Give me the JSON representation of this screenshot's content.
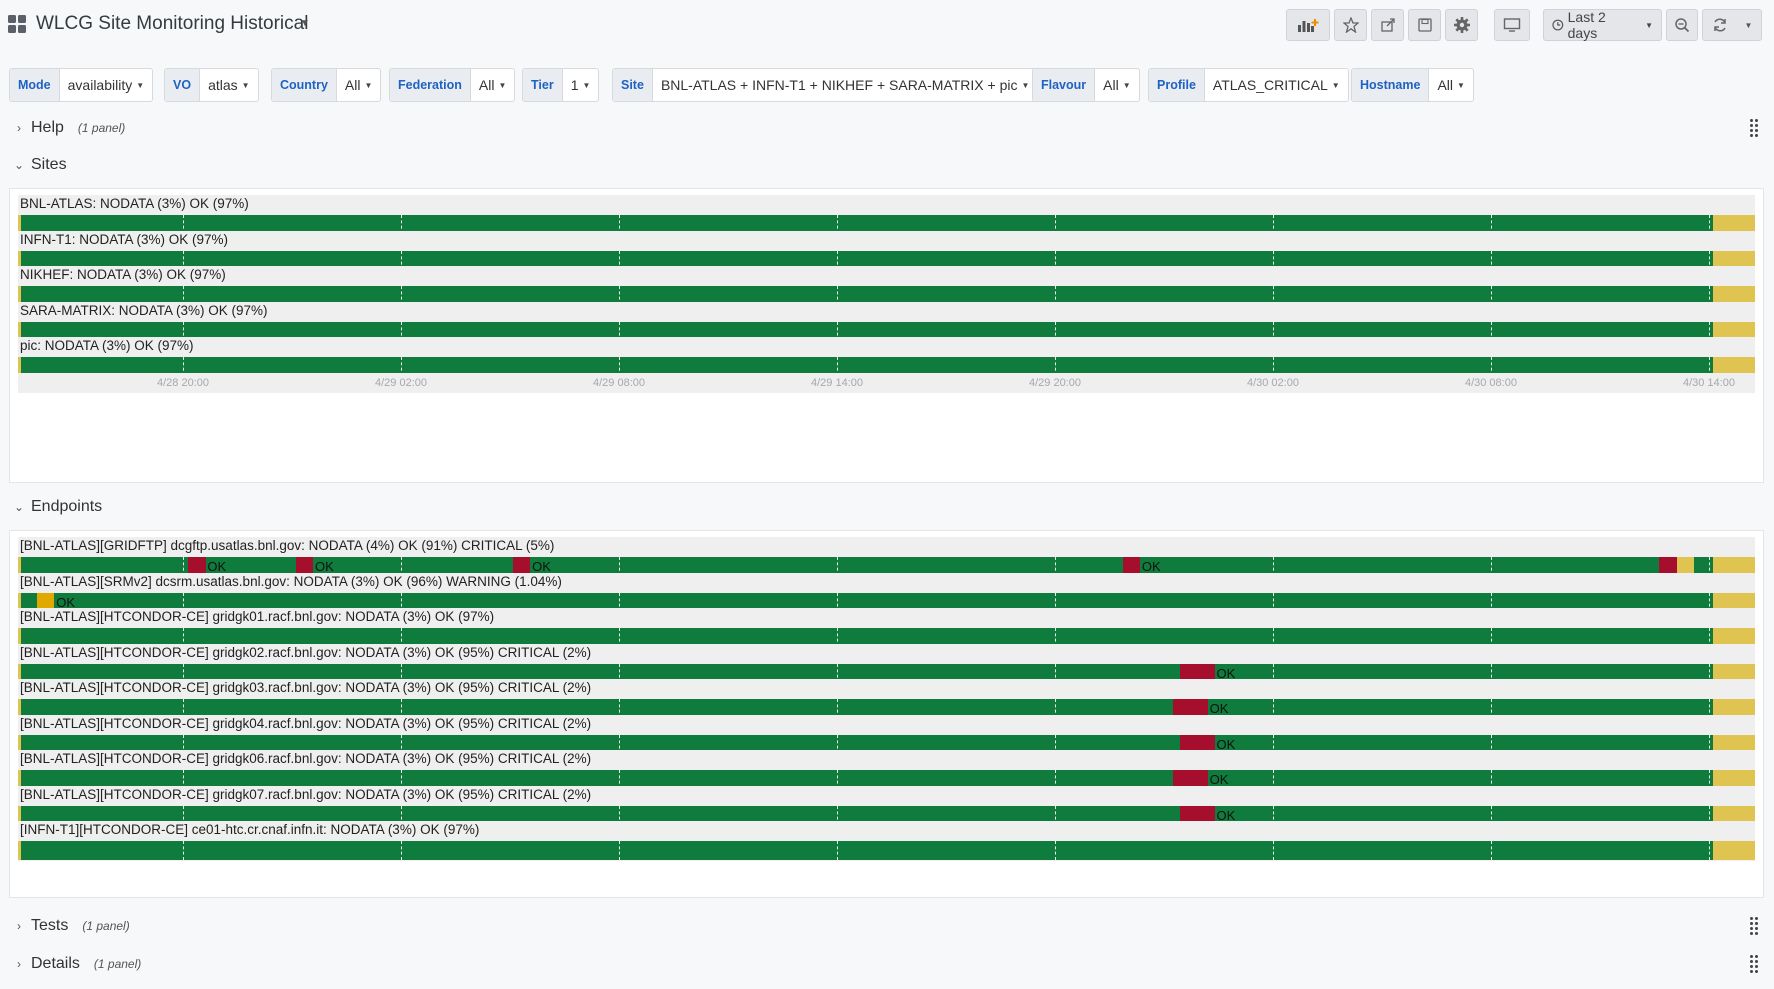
{
  "dashboard": {
    "title": "WLCG Site Monitoring Historical",
    "time_range": "Last 2 days"
  },
  "toolbar": {
    "icons": [
      "add-panel-icon",
      "star-icon",
      "share-icon",
      "save-icon",
      "gear-icon",
      "tv-mode-icon",
      "clock-icon",
      "zoom-out-icon",
      "refresh-icon",
      "chevron-down-icon"
    ]
  },
  "variables": [
    {
      "label": "Mode",
      "value": "availability"
    },
    {
      "label": "VO",
      "value": "atlas"
    },
    {
      "label": "Country",
      "value": "All"
    },
    {
      "label": "Federation",
      "value": "All"
    },
    {
      "label": "Tier",
      "value": "1"
    },
    {
      "label": "Site",
      "value": "BNL-ATLAS + INFN-T1 + NIKHEF + SARA-MATRIX + pic"
    },
    {
      "label": "Flavour",
      "value": "All"
    },
    {
      "label": "Profile",
      "value": "ATLAS_CRITICAL"
    },
    {
      "label": "Hostname",
      "value": "All"
    }
  ],
  "rows": {
    "help": {
      "title": "Help",
      "count": "(1 panel)"
    },
    "sites": {
      "title": "Sites"
    },
    "endpoints": {
      "title": "Endpoints"
    },
    "tests": {
      "title": "Tests",
      "count": "(1 panel)"
    },
    "details": {
      "title": "Details",
      "count": "(1 panel)"
    }
  },
  "colors": {
    "ok": "#0f7b3c",
    "critical": "#a50f2d",
    "warning": "#e0a800",
    "nodata": "#dfc452"
  },
  "time_axis": {
    "ticks": [
      "4/28 20:00",
      "4/29 02:00",
      "4/29 08:00",
      "4/29 14:00",
      "4/29 20:00",
      "4/30 02:00",
      "4/30 08:00",
      "4/30 14:00"
    ],
    "tick_fractions": [
      0.095,
      0.2205,
      0.346,
      0.4715,
      0.597,
      0.7225,
      0.848,
      0.9735
    ]
  },
  "sites": [
    {
      "label": "BNL-ATLAS: NODATA (3%) OK (97%)",
      "segments": [
        {
          "state": "nodata",
          "start": 0.0,
          "end": 0.002
        },
        {
          "state": "ok",
          "start": 0.002,
          "end": 0.974
        },
        {
          "state": "nodata",
          "start": 0.976,
          "end": 1.0
        }
      ]
    },
    {
      "label": "INFN-T1: NODATA (3%) OK (97%)",
      "segments": [
        {
          "state": "nodata",
          "start": 0.0,
          "end": 0.002
        },
        {
          "state": "ok",
          "start": 0.002,
          "end": 0.974
        },
        {
          "state": "nodata",
          "start": 0.976,
          "end": 1.0
        }
      ]
    },
    {
      "label": "NIKHEF: NODATA (3%) OK (97%)",
      "segments": [
        {
          "state": "nodata",
          "start": 0.0,
          "end": 0.002
        },
        {
          "state": "ok",
          "start": 0.002,
          "end": 0.974
        },
        {
          "state": "nodata",
          "start": 0.976,
          "end": 1.0
        }
      ]
    },
    {
      "label": "SARA-MATRIX: NODATA (3%) OK (97%)",
      "segments": [
        {
          "state": "nodata",
          "start": 0.0,
          "end": 0.002
        },
        {
          "state": "ok",
          "start": 0.002,
          "end": 0.974
        },
        {
          "state": "nodata",
          "start": 0.976,
          "end": 1.0
        }
      ]
    },
    {
      "label": "pic: NODATA (3%) OK (97%)",
      "segments": [
        {
          "state": "nodata",
          "start": 0.0,
          "end": 0.002
        },
        {
          "state": "ok",
          "start": 0.002,
          "end": 0.974
        },
        {
          "state": "nodata",
          "start": 0.976,
          "end": 1.0
        }
      ]
    }
  ],
  "endpoints": [
    {
      "label": "[BNL-ATLAS][GRIDFTP] dcgftp.usatlas.bnl.gov: NODATA (4%) OK (91%) CRITICAL (5%)",
      "segments": [
        {
          "state": "nodata",
          "start": 0.0,
          "end": 0.002
        },
        {
          "state": "critical",
          "start": 0.098,
          "end": 0.108
        },
        {
          "state": "critical",
          "start": 0.16,
          "end": 0.17
        },
        {
          "state": "critical",
          "start": 0.285,
          "end": 0.295
        },
        {
          "state": "critical",
          "start": 0.636,
          "end": 0.646
        },
        {
          "state": "critical",
          "start": 0.945,
          "end": 0.955
        },
        {
          "state": "nodata",
          "start": 0.955,
          "end": 0.965
        },
        {
          "state": "nodata",
          "start": 0.976,
          "end": 1.0
        }
      ],
      "annotations": [
        {
          "text": "OK",
          "at": 0.109
        },
        {
          "text": "OK",
          "at": 0.171
        },
        {
          "text": "OK",
          "at": 0.296
        },
        {
          "text": "OK",
          "at": 0.647
        }
      ]
    },
    {
      "label": "[BNL-ATLAS][SRMv2] dcsrm.usatlas.bnl.gov: NODATA (3%) OK (96%) WARNING (1.04%)",
      "segments": [
        {
          "state": "nodata",
          "start": 0.0,
          "end": 0.002
        },
        {
          "state": "warning",
          "start": 0.011,
          "end": 0.021
        },
        {
          "state": "nodata",
          "start": 0.976,
          "end": 1.0
        }
      ],
      "annotations": [
        {
          "text": "OK",
          "at": 0.022
        }
      ]
    },
    {
      "label": "[BNL-ATLAS][HTCONDOR-CE] gridgk01.racf.bnl.gov: NODATA (3%) OK (97%)",
      "segments": [
        {
          "state": "nodata",
          "start": 0.0,
          "end": 0.002
        },
        {
          "state": "nodata",
          "start": 0.976,
          "end": 1.0
        }
      ],
      "annotations": []
    },
    {
      "label": "[BNL-ATLAS][HTCONDOR-CE] gridgk02.racf.bnl.gov: NODATA (3%) OK (95%) CRITICAL (2%)",
      "segments": [
        {
          "state": "nodata",
          "start": 0.0,
          "end": 0.002
        },
        {
          "state": "critical",
          "start": 0.669,
          "end": 0.689
        },
        {
          "state": "nodata",
          "start": 0.976,
          "end": 1.0
        }
      ],
      "annotations": [
        {
          "text": "OK",
          "at": 0.69
        }
      ]
    },
    {
      "label": "[BNL-ATLAS][HTCONDOR-CE] gridgk03.racf.bnl.gov: NODATA (3%) OK (95%) CRITICAL (2%)",
      "segments": [
        {
          "state": "nodata",
          "start": 0.0,
          "end": 0.002
        },
        {
          "state": "critical",
          "start": 0.665,
          "end": 0.685
        },
        {
          "state": "nodata",
          "start": 0.976,
          "end": 1.0
        }
      ],
      "annotations": [
        {
          "text": "OK",
          "at": 0.686
        }
      ]
    },
    {
      "label": "[BNL-ATLAS][HTCONDOR-CE] gridgk04.racf.bnl.gov: NODATA (3%) OK (95%) CRITICAL (2%)",
      "segments": [
        {
          "state": "nodata",
          "start": 0.0,
          "end": 0.002
        },
        {
          "state": "critical",
          "start": 0.669,
          "end": 0.689
        },
        {
          "state": "nodata",
          "start": 0.976,
          "end": 1.0
        }
      ],
      "annotations": [
        {
          "text": "OK",
          "at": 0.69
        }
      ]
    },
    {
      "label": "[BNL-ATLAS][HTCONDOR-CE] gridgk06.racf.bnl.gov: NODATA (3%) OK (95%) CRITICAL (2%)",
      "segments": [
        {
          "state": "nodata",
          "start": 0.0,
          "end": 0.002
        },
        {
          "state": "critical",
          "start": 0.665,
          "end": 0.685
        },
        {
          "state": "nodata",
          "start": 0.976,
          "end": 1.0
        }
      ],
      "annotations": [
        {
          "text": "OK",
          "at": 0.686
        }
      ]
    },
    {
      "label": "[BNL-ATLAS][HTCONDOR-CE] gridgk07.racf.bnl.gov: NODATA (3%) OK (95%) CRITICAL (2%)",
      "segments": [
        {
          "state": "nodata",
          "start": 0.0,
          "end": 0.002
        },
        {
          "state": "critical",
          "start": 0.669,
          "end": 0.689
        },
        {
          "state": "nodata",
          "start": 0.976,
          "end": 1.0
        }
      ],
      "annotations": [
        {
          "text": "OK",
          "at": 0.69
        }
      ]
    },
    {
      "label": "[INFN-T1][HTCONDOR-CE] ce01-htc.cr.cnaf.infn.it: NODATA (3%) OK (97%)",
      "segments": [
        {
          "state": "nodata",
          "start": 0.0,
          "end": 0.002
        },
        {
          "state": "nodata",
          "start": 0.976,
          "end": 1.0
        }
      ],
      "annotations": []
    }
  ]
}
